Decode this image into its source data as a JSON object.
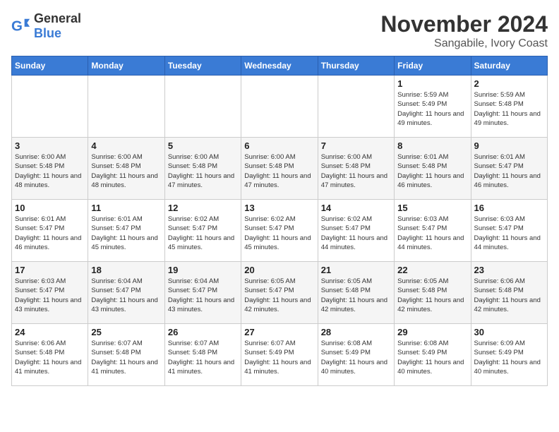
{
  "logo": {
    "text_general": "General",
    "text_blue": "Blue"
  },
  "header": {
    "month_title": "November 2024",
    "location": "Sangabile, Ivory Coast"
  },
  "weekdays": [
    "Sunday",
    "Monday",
    "Tuesday",
    "Wednesday",
    "Thursday",
    "Friday",
    "Saturday"
  ],
  "weeks": [
    [
      {
        "day": "",
        "info": ""
      },
      {
        "day": "",
        "info": ""
      },
      {
        "day": "",
        "info": ""
      },
      {
        "day": "",
        "info": ""
      },
      {
        "day": "",
        "info": ""
      },
      {
        "day": "1",
        "info": "Sunrise: 5:59 AM\nSunset: 5:49 PM\nDaylight: 11 hours and 49 minutes."
      },
      {
        "day": "2",
        "info": "Sunrise: 5:59 AM\nSunset: 5:48 PM\nDaylight: 11 hours and 49 minutes."
      }
    ],
    [
      {
        "day": "3",
        "info": "Sunrise: 6:00 AM\nSunset: 5:48 PM\nDaylight: 11 hours and 48 minutes."
      },
      {
        "day": "4",
        "info": "Sunrise: 6:00 AM\nSunset: 5:48 PM\nDaylight: 11 hours and 48 minutes."
      },
      {
        "day": "5",
        "info": "Sunrise: 6:00 AM\nSunset: 5:48 PM\nDaylight: 11 hours and 47 minutes."
      },
      {
        "day": "6",
        "info": "Sunrise: 6:00 AM\nSunset: 5:48 PM\nDaylight: 11 hours and 47 minutes."
      },
      {
        "day": "7",
        "info": "Sunrise: 6:00 AM\nSunset: 5:48 PM\nDaylight: 11 hours and 47 minutes."
      },
      {
        "day": "8",
        "info": "Sunrise: 6:01 AM\nSunset: 5:48 PM\nDaylight: 11 hours and 46 minutes."
      },
      {
        "day": "9",
        "info": "Sunrise: 6:01 AM\nSunset: 5:47 PM\nDaylight: 11 hours and 46 minutes."
      }
    ],
    [
      {
        "day": "10",
        "info": "Sunrise: 6:01 AM\nSunset: 5:47 PM\nDaylight: 11 hours and 46 minutes."
      },
      {
        "day": "11",
        "info": "Sunrise: 6:01 AM\nSunset: 5:47 PM\nDaylight: 11 hours and 45 minutes."
      },
      {
        "day": "12",
        "info": "Sunrise: 6:02 AM\nSunset: 5:47 PM\nDaylight: 11 hours and 45 minutes."
      },
      {
        "day": "13",
        "info": "Sunrise: 6:02 AM\nSunset: 5:47 PM\nDaylight: 11 hours and 45 minutes."
      },
      {
        "day": "14",
        "info": "Sunrise: 6:02 AM\nSunset: 5:47 PM\nDaylight: 11 hours and 44 minutes."
      },
      {
        "day": "15",
        "info": "Sunrise: 6:03 AM\nSunset: 5:47 PM\nDaylight: 11 hours and 44 minutes."
      },
      {
        "day": "16",
        "info": "Sunrise: 6:03 AM\nSunset: 5:47 PM\nDaylight: 11 hours and 44 minutes."
      }
    ],
    [
      {
        "day": "17",
        "info": "Sunrise: 6:03 AM\nSunset: 5:47 PM\nDaylight: 11 hours and 43 minutes."
      },
      {
        "day": "18",
        "info": "Sunrise: 6:04 AM\nSunset: 5:47 PM\nDaylight: 11 hours and 43 minutes."
      },
      {
        "day": "19",
        "info": "Sunrise: 6:04 AM\nSunset: 5:47 PM\nDaylight: 11 hours and 43 minutes."
      },
      {
        "day": "20",
        "info": "Sunrise: 6:05 AM\nSunset: 5:47 PM\nDaylight: 11 hours and 42 minutes."
      },
      {
        "day": "21",
        "info": "Sunrise: 6:05 AM\nSunset: 5:48 PM\nDaylight: 11 hours and 42 minutes."
      },
      {
        "day": "22",
        "info": "Sunrise: 6:05 AM\nSunset: 5:48 PM\nDaylight: 11 hours and 42 minutes."
      },
      {
        "day": "23",
        "info": "Sunrise: 6:06 AM\nSunset: 5:48 PM\nDaylight: 11 hours and 42 minutes."
      }
    ],
    [
      {
        "day": "24",
        "info": "Sunrise: 6:06 AM\nSunset: 5:48 PM\nDaylight: 11 hours and 41 minutes."
      },
      {
        "day": "25",
        "info": "Sunrise: 6:07 AM\nSunset: 5:48 PM\nDaylight: 11 hours and 41 minutes."
      },
      {
        "day": "26",
        "info": "Sunrise: 6:07 AM\nSunset: 5:48 PM\nDaylight: 11 hours and 41 minutes."
      },
      {
        "day": "27",
        "info": "Sunrise: 6:07 AM\nSunset: 5:49 PM\nDaylight: 11 hours and 41 minutes."
      },
      {
        "day": "28",
        "info": "Sunrise: 6:08 AM\nSunset: 5:49 PM\nDaylight: 11 hours and 40 minutes."
      },
      {
        "day": "29",
        "info": "Sunrise: 6:08 AM\nSunset: 5:49 PM\nDaylight: 11 hours and 40 minutes."
      },
      {
        "day": "30",
        "info": "Sunrise: 6:09 AM\nSunset: 5:49 PM\nDaylight: 11 hours and 40 minutes."
      }
    ]
  ]
}
